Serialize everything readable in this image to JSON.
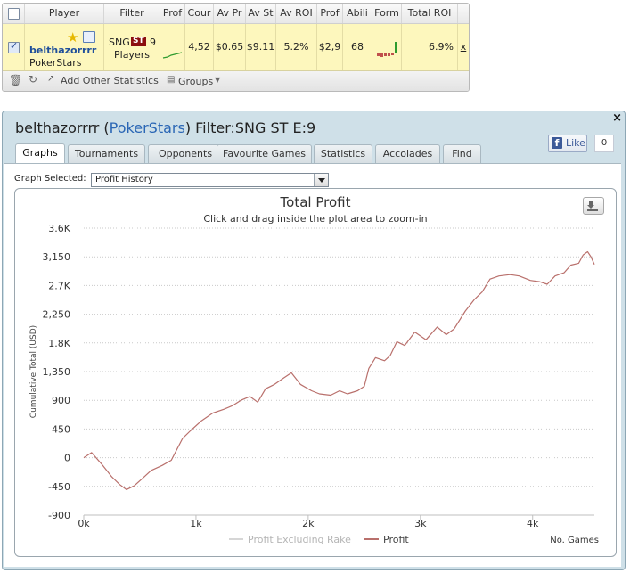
{
  "table": {
    "headers": [
      "",
      "Player",
      "Filter",
      "Prof",
      "Cour",
      "Av Pr",
      "Av St",
      "Av ROI",
      "Prof",
      "Abili",
      "Form",
      "Total ROI"
    ],
    "row": {
      "player_name": "belthazorrrr",
      "site": "PokerStars",
      "filter_game": "SNG",
      "filter_badge": "ST",
      "filter_players_count": "9",
      "filter_players_label": "Players",
      "count": "4,52",
      "av_profit": "$0.65",
      "av_stake": "$9.11",
      "av_roi": "5.2%",
      "profit": "$2,9",
      "ability": "68",
      "total_roi": "6.9%",
      "close": "x"
    },
    "footer": {
      "add_stats_label": "Add Other Statistics",
      "groups_label": "Groups"
    }
  },
  "panel": {
    "title_player": "belthazorrrr",
    "title_open_paren": "(",
    "title_site": "PokerStars",
    "title_filter": ") Filter:SNG ST E:9",
    "close": "×",
    "like_label": "Like",
    "like_count": "0",
    "tabs": [
      "Graphs",
      "Tournaments",
      "Opponents",
      "Favourite Games",
      "Statistics",
      "Accolades",
      "Find"
    ],
    "active_tab": "Graphs",
    "graph_selected_label": "Graph Selected:",
    "graph_selected_value": "Profit History"
  },
  "chart_data": {
    "type": "line",
    "title": "Total Profit",
    "subtitle": "Click and drag inside the plot area to zoom-in",
    "ylabel": "Cumulative Total (USD)",
    "xlabel": "No. Games",
    "x_ticks": [
      "0k",
      "1k",
      "2k",
      "3k",
      "4k"
    ],
    "y_ticks": [
      "3.6K",
      "3,150",
      "2.7K",
      "2,250",
      "1.8K",
      "1,350",
      "900",
      "450",
      "0",
      "-450",
      "-900"
    ],
    "ylim": [
      -900,
      3600
    ],
    "xlim": [
      0,
      4550
    ],
    "grid": true,
    "legend_position": "bottom-center",
    "series": [
      {
        "name": "Profit Excluding Rake",
        "color": "#d6d6d6",
        "visible": false,
        "x": [],
        "y": []
      },
      {
        "name": "Profit",
        "color": "#b9706c",
        "visible": true,
        "x": [
          0,
          70,
          160,
          250,
          320,
          380,
          450,
          520,
          600,
          700,
          780,
          880,
          950,
          1050,
          1150,
          1250,
          1330,
          1400,
          1480,
          1550,
          1620,
          1700,
          1780,
          1850,
          1930,
          2030,
          2100,
          2200,
          2280,
          2350,
          2440,
          2500,
          2540,
          2600,
          2680,
          2730,
          2790,
          2860,
          2950,
          3050,
          3150,
          3230,
          3300,
          3400,
          3480,
          3550,
          3620,
          3700,
          3800,
          3880,
          3980,
          4060,
          4130,
          4200,
          4280,
          4340,
          4410,
          4450,
          4490,
          4520,
          4550
        ],
        "y": [
          0,
          80,
          -100,
          -300,
          -420,
          -500,
          -440,
          -330,
          -200,
          -120,
          -40,
          300,
          420,
          580,
          700,
          760,
          820,
          900,
          960,
          870,
          1080,
          1150,
          1250,
          1330,
          1150,
          1050,
          1000,
          980,
          1050,
          1000,
          1050,
          1120,
          1400,
          1570,
          1520,
          1600,
          1820,
          1760,
          1970,
          1850,
          2050,
          1930,
          2020,
          2300,
          2480,
          2600,
          2800,
          2850,
          2870,
          2850,
          2780,
          2760,
          2720,
          2850,
          2900,
          3020,
          3050,
          3180,
          3230,
          3150,
          3030
        ]
      }
    ]
  }
}
